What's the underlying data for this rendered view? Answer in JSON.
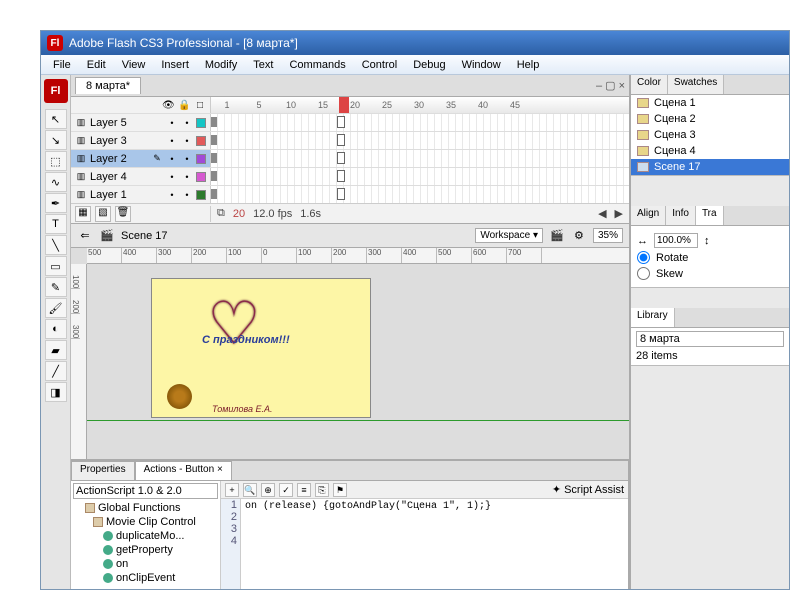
{
  "titlebar": {
    "app_icon": "Fl",
    "title": "Adobe Flash CS3 Professional - [8 марта*]"
  },
  "menu": [
    "File",
    "Edit",
    "View",
    "Insert",
    "Modify",
    "Text",
    "Commands",
    "Control",
    "Debug",
    "Window",
    "Help"
  ],
  "doc_tab": "8 марта*",
  "doc_winctrl": "– ▢ ×",
  "timeline": {
    "ticks": [
      "1",
      "5",
      "10",
      "15",
      "20",
      "25",
      "30",
      "35",
      "40",
      "45"
    ],
    "layers": [
      {
        "name": "Layer 5",
        "color": "#15c5c5",
        "selected": false
      },
      {
        "name": "Layer 3",
        "color": "#e25a5a",
        "selected": false
      },
      {
        "name": "Layer 2",
        "color": "#a14bd6",
        "selected": true
      },
      {
        "name": "Layer 4",
        "color": "#d65ad0",
        "selected": false
      },
      {
        "name": "Layer 1",
        "color": "#2c7a2c",
        "selected": false
      }
    ],
    "footer": {
      "frame": "20",
      "fps": "12.0 fps",
      "time": "1.6s"
    }
  },
  "scene_bar": {
    "scene": "Scene 17",
    "workspace_label": "Workspace ▾",
    "zoom": "35%"
  },
  "ruler_h": [
    "500",
    "400",
    "300",
    "200",
    "100",
    "0",
    "100",
    "200",
    "300",
    "400",
    "500",
    "600",
    "700"
  ],
  "ruler_v": [
    "100",
    "200",
    "300"
  ],
  "stage": {
    "greeting": "С праздником!!!",
    "signature": "Томилова Е.А."
  },
  "actions": {
    "tabs": [
      "Properties",
      "Actions - Button ×"
    ],
    "version_select": "ActionScript 1.0 & 2.0",
    "tree": [
      {
        "type": "folder",
        "label": "Global Functions"
      },
      {
        "type": "folder",
        "label": "Movie Clip Control"
      },
      {
        "type": "fn",
        "label": "duplicateMo..."
      },
      {
        "type": "fn",
        "label": "getProperty"
      },
      {
        "type": "fn",
        "label": "on"
      },
      {
        "type": "fn",
        "label": "onClipEvent"
      }
    ],
    "assist_label": "Script Assist",
    "code": "on (release) {gotoAndPlay(\"Сцена 1\", 1);}",
    "gutter": [
      "1",
      "2",
      "3",
      "4"
    ]
  },
  "scenes_panel": {
    "tabs": [
      "Color",
      "Swatches"
    ],
    "items": [
      "Сцена 1",
      "Сцена 2",
      "Сцена 3",
      "Сцена 4",
      "Scene 17"
    ],
    "selected": "Scene 17"
  },
  "align_panel": {
    "tabs": [
      "Align",
      "Info",
      "Tra"
    ]
  },
  "transform": {
    "scale": "100.0%",
    "rotate_label": "Rotate",
    "skew_label": "Skew"
  },
  "library": {
    "tab": "Library",
    "doc": "8 марта",
    "count": "28 items"
  }
}
